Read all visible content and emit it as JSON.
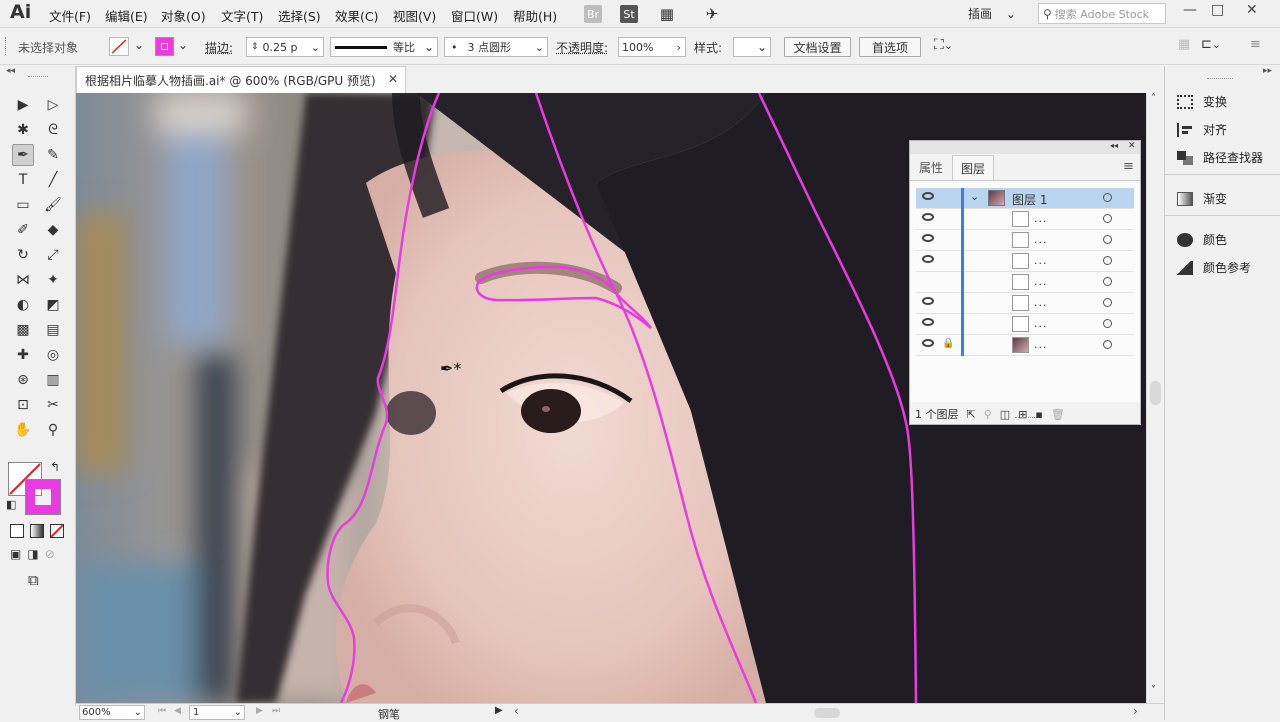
{
  "app": {
    "logo": "Ai"
  },
  "menu": [
    "文件(F)",
    "编辑(E)",
    "对象(O)",
    "文字(T)",
    "选择(S)",
    "效果(C)",
    "视图(V)",
    "窗口(W)",
    "帮助(H)"
  ],
  "menu_icons": {
    "br": "Br",
    "st": "St",
    "arrange": "▦",
    "gpu": "✈"
  },
  "workspace": {
    "label": "插画",
    "chevron": "⌄"
  },
  "search": {
    "placeholder": "搜索 Adobe Stock"
  },
  "window_controls": {
    "minimize": "—",
    "restore": "□",
    "close": "✕"
  },
  "control_bar": {
    "no_selection": "未选择对象",
    "stroke_label": "描边:",
    "stroke_value": "0.25 p",
    "stroke_profile": "等比",
    "brush_label": "3 点圆形",
    "brush_dot": "•",
    "opacity_label": "不透明度:",
    "opacity_value": "100%",
    "style_label": "样式:",
    "doc_setup": "文档设置",
    "preferences": "首选项",
    "chevron": "⌄",
    "arrow_right": "›"
  },
  "document_tab": {
    "title": "根据相片临摹人物插画.ai* @ 600% (RGB/GPU 预览)",
    "close": "✕"
  },
  "tools": [
    [
      "selection-tool",
      "▶"
    ],
    [
      "direct-selection-tool",
      "▷"
    ],
    [
      "magic-wand-tool",
      "✱"
    ],
    [
      "lasso-tool",
      "ᘓ"
    ],
    [
      "pen-tool",
      "✒"
    ],
    [
      "curvature-tool",
      "✎"
    ],
    [
      "type-tool",
      "T"
    ],
    [
      "line-segment-tool",
      "╱"
    ],
    [
      "rectangle-tool",
      "▭"
    ],
    [
      "paintbrush-tool",
      "🖌"
    ],
    [
      "shaper-tool",
      "✐"
    ],
    [
      "eraser-tool",
      "◆"
    ],
    [
      "rotate-tool",
      "↻"
    ],
    [
      "scale-tool",
      "⤢"
    ],
    [
      "width-tool",
      "⋈"
    ],
    [
      "puppet-warp-tool",
      "✦"
    ],
    [
      "shape-builder-tool",
      "◐"
    ],
    [
      "perspective-grid-tool",
      "◩"
    ],
    [
      "mesh-tool",
      "▩"
    ],
    [
      "gradient-tool",
      "▤"
    ],
    [
      "eyedropper-tool",
      "✚"
    ],
    [
      "blend-tool",
      "◎"
    ],
    [
      "symbol-sprayer-tool",
      "⊛"
    ],
    [
      "column-graph-tool",
      "▥"
    ],
    [
      "artboard-tool",
      "⊡"
    ],
    [
      "slice-tool",
      "✂"
    ],
    [
      "hand-tool",
      "✋"
    ],
    [
      "zoom-tool",
      "⚲"
    ]
  ],
  "fill_stroke": {
    "fill_color": "#ffffff",
    "stroke_color": "#e83be0",
    "swap": "↰",
    "default": "◧"
  },
  "draw_modes": {
    "normal": "▣",
    "gradient": "◨",
    "none": "⊘"
  },
  "screen_mode": "⧉",
  "canvas": {
    "cursor": "✒*",
    "path_color": "#e83be0"
  },
  "status": {
    "zoom": "600%",
    "artboard": "1",
    "tool_name": "钢笔",
    "chevron": "⌄",
    "first": "⏮",
    "prev": "◀",
    "next": "▶",
    "last": "⏭",
    "play": "▶",
    "scroll_left": "‹",
    "scroll_right": "›",
    "scroll_up": "˄",
    "scroll_down": "˅"
  },
  "right_panel": {
    "collapse": "▸▸",
    "items": [
      {
        "name": "transform",
        "label": "变换"
      },
      {
        "name": "align",
        "label": "对齐"
      },
      {
        "name": "pathfinder",
        "label": "路径查找器"
      },
      {
        "name": "gradient",
        "label": "渐变"
      },
      {
        "name": "color",
        "label": "颜色"
      },
      {
        "name": "color-guide",
        "label": "颜色参考"
      }
    ]
  },
  "layers_panel": {
    "tab_properties": "属性",
    "tab_layers": "图层",
    "menu": "≡",
    "collapse": "◂◂",
    "close": "✕",
    "parent": {
      "name": "图层 1",
      "chevron": "⌄"
    },
    "rows": [
      {
        "label": "...",
        "visible": true,
        "locked": false
      },
      {
        "label": "...",
        "visible": true,
        "locked": false
      },
      {
        "label": "...",
        "visible": true,
        "locked": false
      },
      {
        "label": "...",
        "visible": false,
        "locked": false
      },
      {
        "label": "...",
        "visible": true,
        "locked": false
      },
      {
        "label": "...",
        "visible": true,
        "locked": false
      },
      {
        "label": "...",
        "visible": true,
        "locked": true
      }
    ],
    "footer": "1 个图层",
    "lock_icon": "🔒"
  }
}
